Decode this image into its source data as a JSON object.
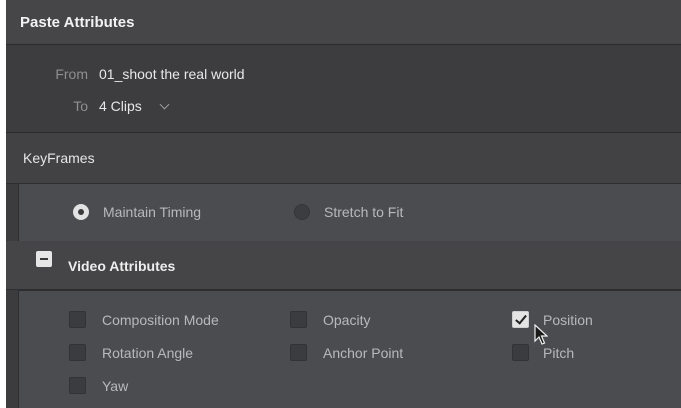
{
  "dialog": {
    "title": "Paste Attributes",
    "from_label": "From",
    "from_value": "01_shoot the real world",
    "to_label": "To",
    "to_value": "4 Clips",
    "to_dropdown_icon": "chevron-down-icon"
  },
  "keyframes": {
    "heading": "KeyFrames",
    "options": [
      {
        "label": "Maintain Timing",
        "selected": true
      },
      {
        "label": "Stretch to Fit",
        "selected": false
      }
    ]
  },
  "video_attributes": {
    "heading": "Video Attributes",
    "collapse_icon": "minus-icon",
    "items": [
      {
        "label": "Composition Mode",
        "checked": false
      },
      {
        "label": "Opacity",
        "checked": false
      },
      {
        "label": "Position",
        "checked": true
      },
      {
        "label": "Rotation Angle",
        "checked": false
      },
      {
        "label": "Anchor Point",
        "checked": false
      },
      {
        "label": "Pitch",
        "checked": false
      },
      {
        "label": "Yaw",
        "checked": false
      }
    ]
  },
  "cursor_icon": "mouse-pointer-icon"
}
